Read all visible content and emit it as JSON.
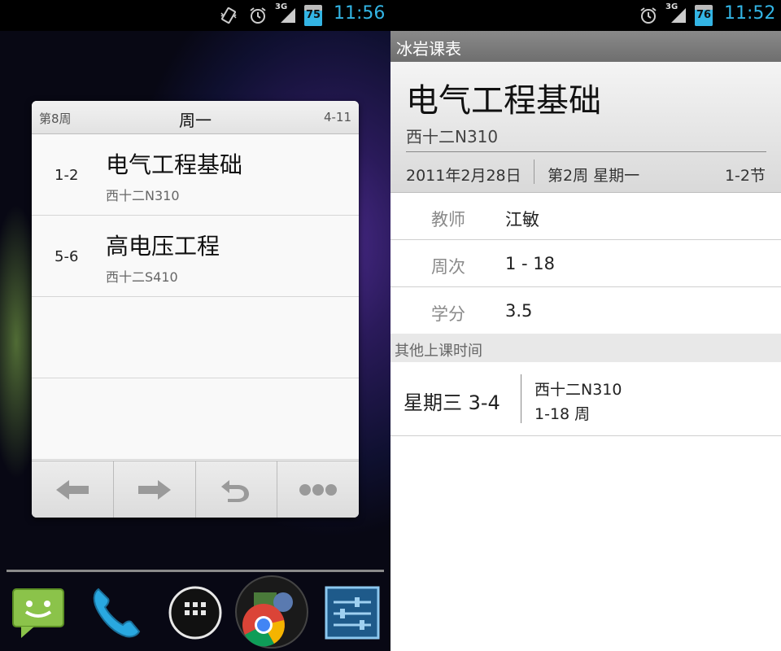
{
  "left_screen": {
    "status_bar": {
      "time": "11:56",
      "battery_level": "75",
      "battery_percent": 75,
      "network": "3G",
      "icons": [
        "vibrate-icon",
        "alarm-icon",
        "signal-icon",
        "battery-icon"
      ]
    },
    "widget": {
      "week": "第8周",
      "day": "周一",
      "date": "4-11",
      "courses": [
        {
          "period": "1-2",
          "name": "电气工程基础",
          "room": "西十二N310"
        },
        {
          "period": "5-6",
          "name": "高电压工程",
          "room": "西十二S410"
        }
      ],
      "nav": [
        "left-arrow-icon",
        "right-arrow-icon",
        "undo-icon",
        "more-icon"
      ]
    },
    "dock": [
      "messaging-icon",
      "phone-icon",
      "app-drawer-icon",
      "chrome-icon",
      "settings-icon"
    ]
  },
  "right_screen": {
    "status_bar": {
      "time": "11:52",
      "battery_level": "76",
      "battery_percent": 76,
      "network": "3G",
      "icons": [
        "alarm-icon",
        "signal-icon",
        "battery-icon"
      ]
    },
    "app_title": "冰岩课表",
    "course": {
      "name": "电气工程基础",
      "room": "西十二N310",
      "date": "2011年2月28日",
      "week_day": "第2周 星期一",
      "period": "1-2节"
    },
    "details": [
      {
        "label": "教师",
        "value": "江敏"
      },
      {
        "label": "周次",
        "value": "1 - 18"
      },
      {
        "label": "学分",
        "value": "3.5"
      }
    ],
    "other_times_header": "其他上课时间",
    "other_times": [
      {
        "time": "星期三 3-4",
        "room": "西十二N310",
        "weeks": "1-18 周"
      }
    ]
  },
  "colors": {
    "accent": "#33b5e5",
    "titlebar": "#7a7a7a"
  }
}
